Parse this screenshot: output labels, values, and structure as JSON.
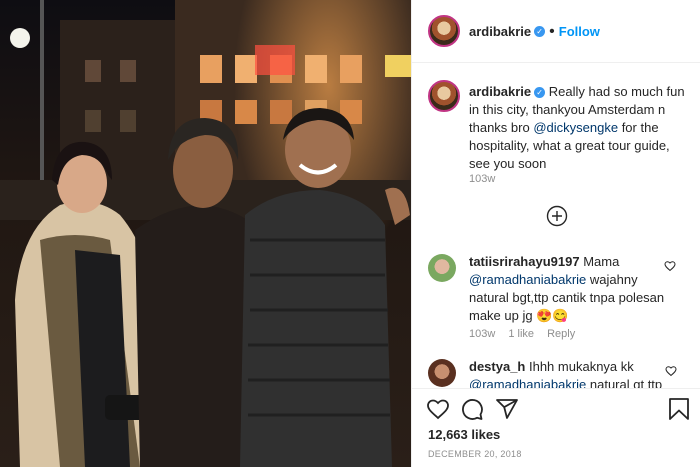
{
  "post": {
    "username": "ardibakrie",
    "follow_label": "Follow",
    "caption_prefix": "Really had so much fun in this city, thankyou Amsterdam n thanks bro ",
    "caption_mention": "@dickysengke",
    "caption_suffix": " for the hospitality, what a great tour guide, see you soon",
    "caption_age": "103w"
  },
  "comments": [
    {
      "username": "tatiisrirahayu9197",
      "text_prefix": " Mama ",
      "mention": "@ramadhaniabakrie",
      "text_suffix": " wajahny natural bgt,ttp cantik tnpa polesan make up jg 😍😋",
      "age": "103w",
      "likes": "1 like",
      "reply": "Reply"
    },
    {
      "username": "destya_h",
      "text_prefix": " Ihhh mukaknya kk",
      "mention": "@ramadhaniabakrie",
      "text_suffix": " natural gt ttp"
    }
  ],
  "stats": {
    "likes": "12,663 likes",
    "date": "December 20, 2018"
  },
  "icons": {
    "load_more": "plus-circle-icon",
    "like": "heart-icon",
    "comment": "comment-icon",
    "share": "share-icon",
    "save": "bookmark-icon"
  },
  "colors": {
    "accent": "#0095f6",
    "verified": "#3897f0",
    "mention": "#00376b",
    "muted": "#8e8e8e"
  }
}
